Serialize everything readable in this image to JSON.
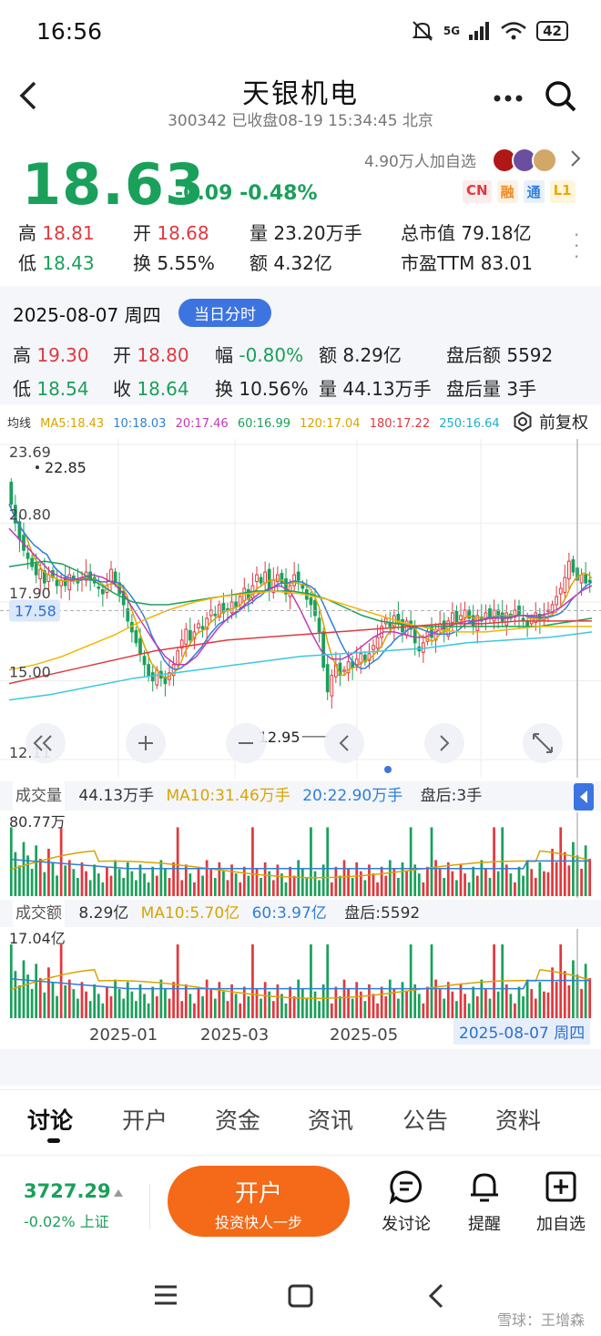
{
  "status": {
    "time": "16:56",
    "network": "5G",
    "battery": "42"
  },
  "nav": {
    "title": "天银机电",
    "subtitle": "300342 已收盘08-19 15:34:45 北京"
  },
  "quote": {
    "price": "18.63",
    "change": "-0.09 -0.48%",
    "followers": "4.90万人加自选",
    "badges": [
      "CN",
      "融",
      "通",
      "L1"
    ],
    "high_label": "高",
    "high": "18.81",
    "open_label": "开",
    "open": "18.68",
    "vol_label": "量",
    "vol": "23.20万手",
    "mcap_label": "总市值",
    "mcap": "79.18亿",
    "low_label": "低",
    "low": "18.43",
    "turn_label": "换",
    "turn": "5.55%",
    "amt_label": "额",
    "amt": "4.32亿",
    "pe_label": "市盈TTM",
    "pe": "83.01"
  },
  "day": {
    "date": "2025-08-07 周四",
    "button": "当日分时",
    "high_label": "高",
    "high": "19.30",
    "open_label": "开",
    "open": "18.80",
    "amp_label": "幅",
    "amp": "-0.80%",
    "amt_label": "额",
    "amt": "8.29亿",
    "after_amt_label": "盘后额",
    "after_amt": "5592",
    "low_label": "低",
    "low": "18.54",
    "close_label": "收",
    "close": "18.64",
    "turn_label": "换",
    "turn": "10.56%",
    "vol_label": "量",
    "vol": "44.13万手",
    "after_vol_label": "盘后量",
    "after_vol": "3手"
  },
  "ma": {
    "label": "均线",
    "ma5": "MA5:18.43",
    "ma10": "10:18.03",
    "ma20": "20:17.46",
    "ma60": "60:16.99",
    "ma120": "120:17.04",
    "ma180": "180:17.22",
    "ma250": "250:16.64",
    "adjust": "前复权",
    "colors": {
      "ma5": "#d9a400",
      "ma10": "#2f7fd9",
      "ma20": "#c23ab8",
      "ma60": "#1aa05a",
      "ma120": "#f2b600",
      "ma180": "#e0393e",
      "ma250": "#3cc8e0"
    }
  },
  "chart_data": {
    "type": "candlestick",
    "y_ticks": [
      "23.69",
      "20.80",
      "17.90",
      "15.00",
      "12.11"
    ],
    "max_label": "22.85",
    "min_label": "12.95",
    "current_label": "17.58",
    "ylim": [
      12.11,
      23.69
    ],
    "x_ticks": [
      "2025-01",
      "2025-03",
      "2025-05"
    ],
    "cursor_label": "2025-08-07 周四",
    "closes": [
      21.5,
      20.8,
      20.2,
      19.8,
      19.5,
      19.2,
      18.9,
      19.1,
      18.6,
      18.9,
      18.8,
      18.5,
      18.7,
      18.5,
      18.9,
      18.7,
      18.6,
      18.8,
      19.0,
      18.7,
      18.6,
      18.4,
      18.2,
      18.5,
      19.1,
      18.6,
      18.2,
      17.8,
      17.2,
      16.8,
      16.4,
      16.0,
      15.6,
      15.2,
      15.0,
      15.4,
      15.1,
      14.9,
      15.3,
      15.6,
      16.1,
      16.5,
      16.9,
      16.5,
      16.8,
      17.1,
      16.9,
      17.3,
      17.6,
      17.4,
      17.8,
      17.5,
      17.6,
      17.9,
      17.7,
      18.1,
      18.4,
      18.0,
      18.5,
      18.9,
      18.6,
      19.0,
      18.4,
      18.7,
      18.9,
      18.6,
      18.2,
      18.5,
      18.9,
      18.7,
      18.4,
      18.0,
      17.8,
      17.4,
      16.8,
      15.5,
      14.6,
      15.2,
      15.6,
      15.2,
      15.4,
      15.7,
      15.5,
      15.8,
      16.0,
      15.7,
      16.0,
      16.3,
      16.6,
      17.0,
      17.3,
      17.0,
      17.4,
      17.1,
      16.8,
      17.2,
      16.9,
      16.4,
      16.1,
      16.4,
      16.8,
      16.6,
      16.9,
      17.1,
      16.8,
      17.2,
      17.5,
      17.1,
      17.4,
      17.6,
      17.3,
      17.0,
      17.4,
      17.2,
      17.5,
      17.3,
      17.6,
      17.4,
      17.2,
      17.5,
      17.3,
      17.6,
      17.4,
      17.2,
      17.0,
      17.3,
      17.5,
      17.2,
      17.4,
      17.6,
      17.8,
      18.1,
      18.4,
      18.8,
      19.4,
      19.0,
      18.7,
      18.9,
      18.6,
      18.63
    ],
    "ma_series": {
      "ma20": [
        20.6,
        20.2,
        19.8,
        19.4,
        19.0,
        18.8,
        18.7,
        18.8,
        18.9,
        18.8,
        18.6,
        18.2,
        17.6,
        17.0,
        16.4,
        15.9,
        15.6,
        15.6,
        15.9,
        16.4,
        16.9,
        17.3,
        17.6,
        17.9,
        18.2,
        18.4,
        18.5,
        18.3,
        17.6,
        16.8,
        16.1,
        15.8,
        15.8,
        16.0,
        16.3,
        16.6,
        16.8,
        16.8,
        16.7,
        16.6,
        16.6,
        16.8,
        17.0,
        17.1,
        17.2,
        17.2,
        17.3,
        17.3,
        17.3,
        17.4,
        17.4,
        17.4,
        17.5,
        17.7,
        18.0,
        18.3,
        18.5
      ],
      "ma60": [
        19.2,
        19.3,
        19.4,
        19.3,
        19.0,
        18.6,
        18.2,
        17.9,
        17.8,
        17.8,
        17.9,
        18.0,
        18.1,
        18.2,
        18.3,
        18.3,
        18.3,
        18.2,
        18.0,
        17.7,
        17.4,
        17.2,
        17.1,
        17.0,
        17.0,
        17.0,
        17.0,
        17.0,
        17.0,
        17.0,
        17.0,
        17.1,
        17.2,
        17.3
      ],
      "ma120": [
        15.4,
        15.6,
        15.9,
        16.3,
        16.7,
        17.2,
        17.6,
        17.9,
        18.1,
        18.2,
        18.3,
        18.2,
        18.0,
        17.7,
        17.4,
        17.1,
        16.9,
        16.8,
        16.8,
        16.9,
        17.0,
        17.0,
        17.0
      ],
      "ma180": [
        14.9,
        15.2,
        15.5,
        15.8,
        16.1,
        16.3,
        16.5,
        16.6,
        16.7,
        16.8,
        16.9,
        17.0,
        17.1,
        17.1,
        17.2,
        17.2,
        17.2
      ],
      "ma250": [
        14.3,
        14.5,
        14.8,
        15.1,
        15.3,
        15.5,
        15.7,
        15.9,
        16.0,
        16.1,
        16.2,
        16.4,
        16.5,
        16.6,
        16.8
      ]
    }
  },
  "volume": {
    "label": "成交量",
    "current": "44.13万手",
    "ma10": "MA10:31.46万手",
    "ma20": "20:22.90万手",
    "after": "盘后:3手",
    "max": "80.77万",
    "spikes": [
      0,
      12,
      40,
      58,
      72,
      76,
      96,
      101,
      116,
      118,
      132,
      140,
      146
    ]
  },
  "amount": {
    "label": "成交额",
    "current": "8.29亿",
    "ma10": "MA10:5.70亿",
    "ma60": "60:3.97亿",
    "after": "盘后:5592",
    "max": "17.04亿"
  },
  "tabs": [
    "讨论",
    "开户",
    "资金",
    "资讯",
    "公告",
    "资料"
  ],
  "bottom": {
    "index_value": "3727.29",
    "index_change": "-0.02% 上证",
    "open_title": "开户",
    "open_sub": "投资快人一步",
    "discuss": "发讨论",
    "remind": "提醒",
    "add": "加自选"
  },
  "watermark": "雪球：王增森"
}
